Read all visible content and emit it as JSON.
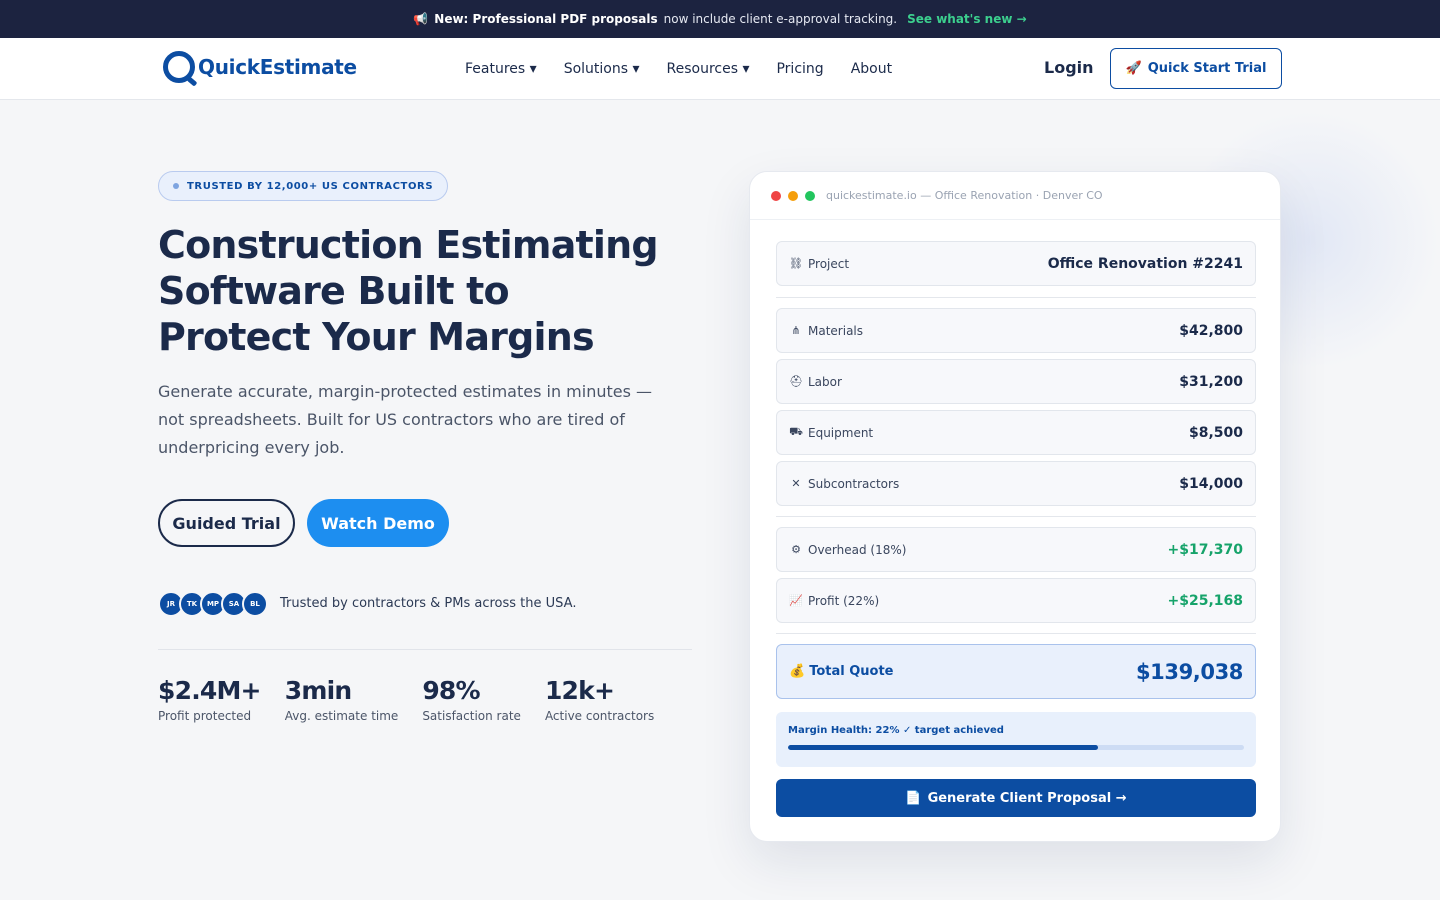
{
  "announcement": {
    "icon": "megaphone-icon",
    "bold_text": "New: Professional PDF proposals",
    "text": "now include client e-approval tracking.",
    "link": "See what's new →"
  },
  "nav": {
    "logo": "QuickEstimate",
    "menu": [
      "Features ▾",
      "Solutions ▾",
      "Resources ▾",
      "Pricing",
      "About"
    ],
    "login": "Login",
    "cta": "Quick Start Trial",
    "cta_icon": "🚀"
  },
  "hero": {
    "badge": "TRUSTED BY 12,000+ US CONTRACTORS",
    "headline_1": "Construction Estimating",
    "headline_2": "Software Built to",
    "headline_3": "Protect Your Margins",
    "subtext": "Generate accurate, margin-protected estimates in minutes — not spreadsheets. Built for US contractors who are tired of underpricing every job.",
    "btn_guided": "Guided Trial",
    "btn_demo": "Watch Demo",
    "avatars": [
      "JR",
      "TK",
      "MP",
      "SA",
      "BL"
    ],
    "trust_text": "Trusted by contractors & PMs across the USA.",
    "stats": [
      {
        "value": "$2.4M+",
        "label": "Profit protected"
      },
      {
        "value": "3min",
        "label": "Avg. estimate time"
      },
      {
        "value": "98%",
        "label": "Satisfaction rate"
      },
      {
        "value": "12k+",
        "label": "Active contractors"
      }
    ]
  },
  "estimator": {
    "window_title": "quickestimate.io — Office Renovation · Denver CO",
    "project_label": "Project",
    "project_value": "Office Renovation #2241",
    "rows": [
      {
        "label": "Materials",
        "value": "$42,800",
        "icon": "sitemap-icon"
      },
      {
        "label": "Labor",
        "value": "$31,200",
        "icon": "hard-hat-icon"
      },
      {
        "label": "Equipment",
        "value": "$8,500",
        "icon": "truck-icon"
      },
      {
        "label": "Subcontractors",
        "value": "$14,000",
        "icon": "tools-icon"
      }
    ],
    "adjustments": [
      {
        "label": "Overhead (18%)",
        "value": "+$17,370",
        "icon": "gears-icon"
      },
      {
        "label": "Profit (22%)",
        "value": "+$25,168",
        "icon": "chart-line-icon"
      }
    ],
    "total_label": "Total Quote",
    "total_value": "$139,038",
    "margin_health": "Margin Health: 22% ✓ target achieved",
    "margin_progress": 0.68,
    "generate_btn": "Generate Client Proposal →"
  },
  "colors": {
    "brand": "#0c4da2",
    "accent": "#1d8ef0",
    "positive": "#16a36a",
    "announce_bg": "#1c2340"
  }
}
